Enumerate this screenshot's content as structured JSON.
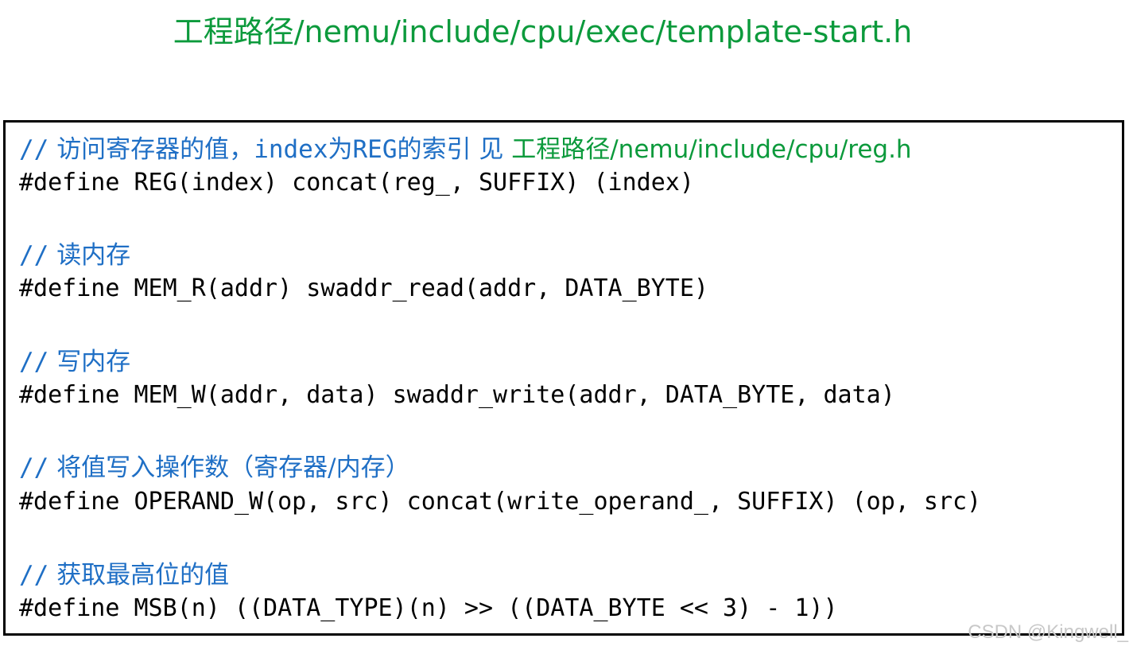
{
  "title": "工程路径/nemu/include/cpu/exec/template-start.h",
  "blocks": [
    {
      "comment_prefix": "//",
      "comment_text": "访问寄存器的值，",
      "comment_code_1": "index",
      "comment_text_2": "为",
      "comment_code_2": "REG",
      "comment_text_3": "的索引 见",
      "comment_path": "工程路径/nemu/include/cpu/reg.h",
      "code": "#define REG(index) concat(reg_, SUFFIX) (index)"
    },
    {
      "comment_prefix": "//",
      "comment_text": "读内存",
      "code": "#define MEM_R(addr) swaddr_read(addr, DATA_BYTE)"
    },
    {
      "comment_prefix": "//",
      "comment_text": "写内存",
      "code": "#define MEM_W(addr, data) swaddr_write(addr, DATA_BYTE, data)"
    },
    {
      "comment_prefix": "//",
      "comment_text": "将值写入操作数（寄存器/内存）",
      "code": "#define OPERAND_W(op, src) concat(write_operand_, SUFFIX) (op, src)"
    },
    {
      "comment_prefix": "//",
      "comment_text": "获取最高位的值",
      "code": "#define MSB(n) ((DATA_TYPE)(n) >> ((DATA_BYTE << 3) - 1))"
    }
  ],
  "watermark": "CSDN @Kingwell_",
  "colors": {
    "title": "#0c9a3c",
    "comment": "#1f6fc5",
    "code": "#000000",
    "border": "#000000"
  }
}
